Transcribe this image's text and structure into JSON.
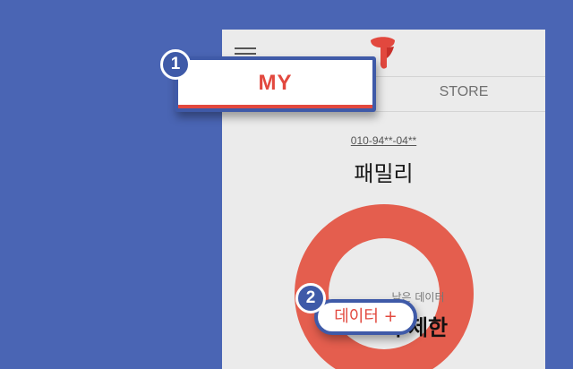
{
  "header": {
    "store_tab": "STORE",
    "menu_icon": "hamburger-menu-icon",
    "logo_icon": "t-brand-logo-icon"
  },
  "account": {
    "phone_number": "010-94**-04**",
    "plan_name": "패밀리"
  },
  "data_gauge": {
    "label": "남은 데이터",
    "value": "무제한",
    "ring_color": "#e45e4e"
  },
  "callouts": {
    "my_tab_label": "MY",
    "data_add_label": "데이터 +",
    "step_1": "1",
    "step_2": "2"
  },
  "colors": {
    "background": "#4a65b4",
    "accent": "#e2483e",
    "badge": "#3f5aa8"
  }
}
